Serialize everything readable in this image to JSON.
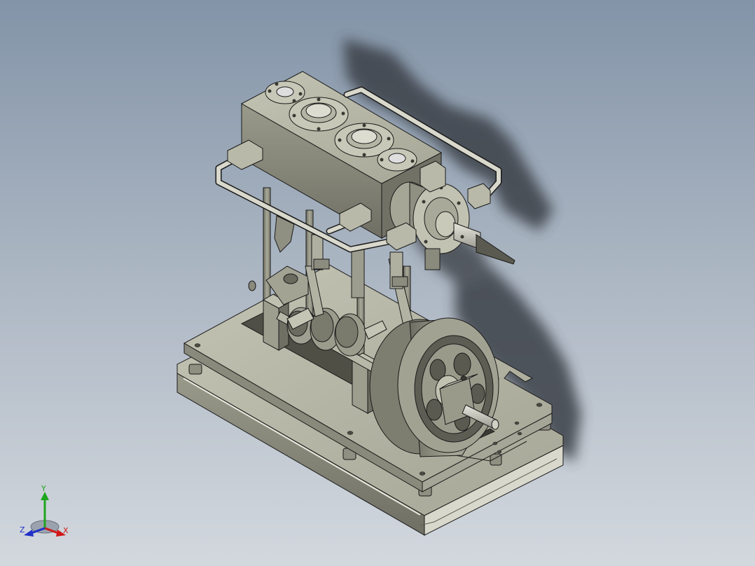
{
  "viewport": {
    "background_top": "#8394a8",
    "background_bottom": "#d3d8de",
    "model": "steam-engine-assembly",
    "shading": "shaded-with-edges",
    "shadow": true
  },
  "triad": {
    "y_label": "Y",
    "x_label": "X",
    "z_label": "Z",
    "y_color": "#1fa51f",
    "x_color": "#d01818",
    "z_color": "#2030c8"
  },
  "colors": {
    "metal_top": "#b9b9a9",
    "metal_side": "#8e8e80",
    "metal_dark": "#5f5f55",
    "edge": "#1a1a1a"
  }
}
